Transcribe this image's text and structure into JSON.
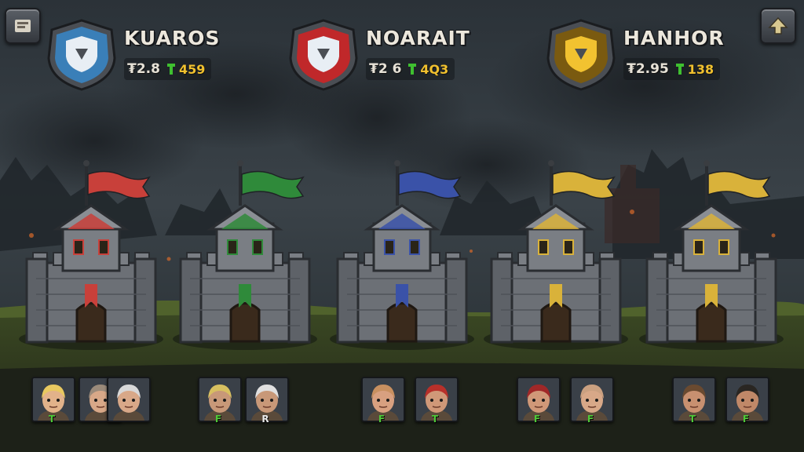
{
  "factions": [
    {
      "id": "kuaros",
      "name": "KUAROS",
      "power": "₮2.8",
      "troops": "459",
      "emblem_color": "#e8eef4",
      "emblem_accent": "#3a7fb8",
      "emblem_icon": "shield-silver-blue-icon"
    },
    {
      "id": "noarait",
      "name": "NOARAIT",
      "power": "₮2 6",
      "troops": "4Q3",
      "emblem_color": "#e8eef4",
      "emblem_accent": "#c0282a",
      "emblem_icon": "shield-silver-red-icon"
    },
    {
      "id": "hanhor",
      "name": "HANHOR",
      "power": "₮2.95",
      "troops": "138",
      "emblem_color": "#f2c230",
      "emblem_accent": "#7a5a10",
      "emblem_icon": "shield-gold-icon"
    }
  ],
  "castles": [
    {
      "name": "castle-red",
      "flag": "#c8403a"
    },
    {
      "name": "castle-green",
      "flag": "#2f8a3a"
    },
    {
      "name": "castle-blue",
      "flag": "#3a52a8"
    },
    {
      "name": "castle-yellow-1",
      "flag": "#d9b23a"
    },
    {
      "name": "castle-yellow-2",
      "flag": "#d9b23a"
    }
  ],
  "heroes": [
    {
      "name": "blonde-hero",
      "hair": "#e8c860",
      "skin": "#e2b28a",
      "level": "T",
      "level_color": "#4fc838"
    },
    {
      "name": "bald-green-eyed-hero",
      "hair": "#9a8a7a",
      "skin": "#d8a888",
      "level": "",
      "level_color": "#4fc838"
    },
    {
      "name": "silver-haired-hero",
      "hair": "#d8d8d8",
      "skin": "#d8a888",
      "level": "",
      "level_color": "#4fc838"
    },
    {
      "name": "blonde-warrior-hero",
      "hair": "#d8c060",
      "skin": "#c89878",
      "level": "F",
      "level_color": "#4fc838"
    },
    {
      "name": "white-haired-elder-hero",
      "hair": "#e0e0e0",
      "skin": "#c89878",
      "level": "R",
      "level_color": "#e8e8e8"
    },
    {
      "name": "blue-masked-hero",
      "hair": "#c89060",
      "skin": "#d8a080",
      "level": "F",
      "level_color": "#4fc838"
    },
    {
      "name": "red-bandana-hero",
      "hair": "#b8302a",
      "skin": "#d09878",
      "level": "T",
      "level_color": "#4fc838"
    },
    {
      "name": "red-hood-hero",
      "hair": "#a02828",
      "skin": "#d09878",
      "level": "F",
      "level_color": "#4fc838"
    },
    {
      "name": "bald-hero",
      "hair": "#caa080",
      "skin": "#d8a888",
      "level": "F",
      "level_color": "#4fc838"
    },
    {
      "name": "bearded-warrior-hero",
      "hair": "#6a4a30",
      "skin": "#c89070",
      "level": "T",
      "level_color": "#4fc838"
    },
    {
      "name": "dark-bearded-hero",
      "hair": "#2a2622",
      "skin": "#c08868",
      "level": "F",
      "level_color": "#4fc838"
    }
  ],
  "colors": {
    "ui_text": "#ece7dc",
    "troop_count": "#f0c02e",
    "troop_icon": "#3fc030"
  }
}
